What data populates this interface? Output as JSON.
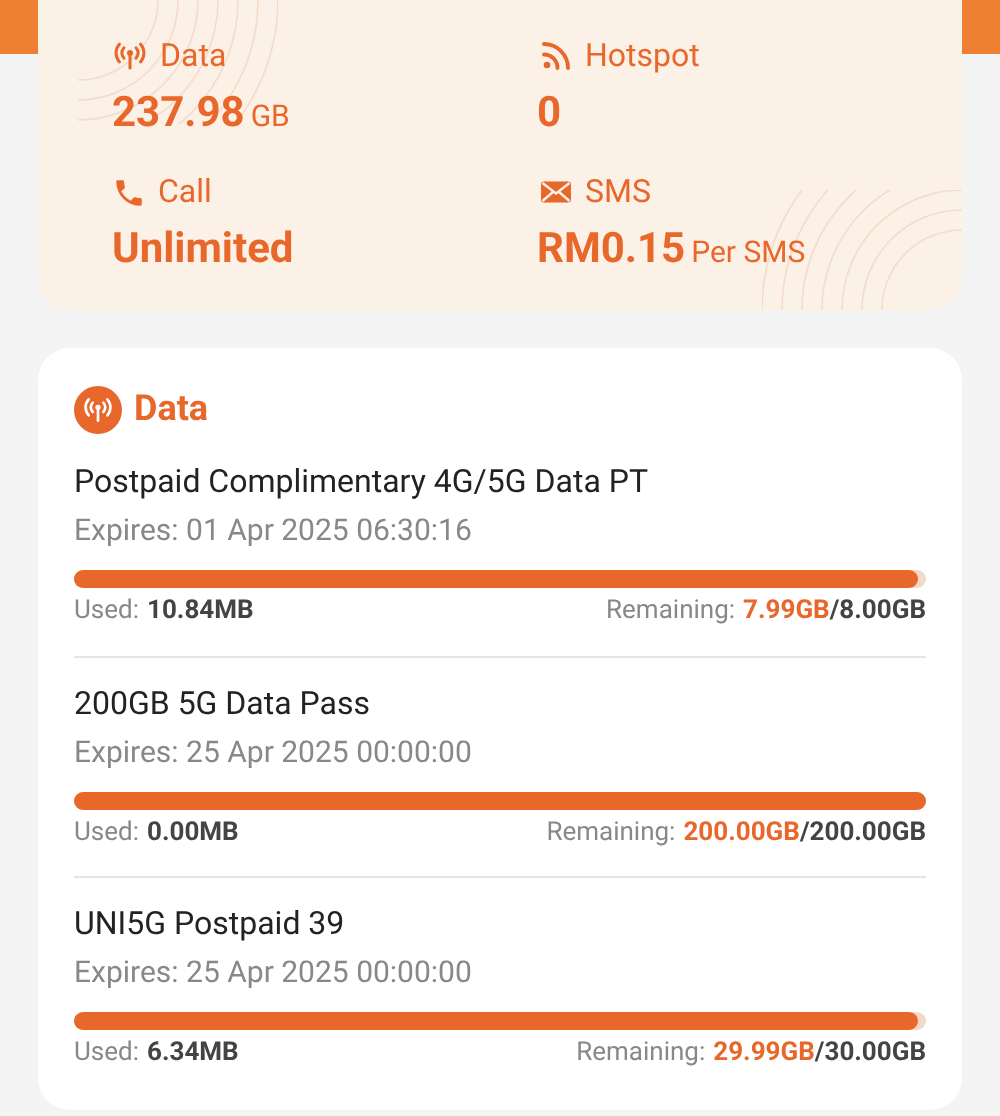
{
  "summary": [
    {
      "kind": "data",
      "label": "Data",
      "value": "237.98",
      "unit": "GB"
    },
    {
      "kind": "hotspot",
      "label": "Hotspot",
      "value": "0"
    },
    {
      "kind": "call",
      "label": "Call",
      "value": "Unlimited"
    },
    {
      "kind": "sms",
      "label": "SMS",
      "value": "RM0.15",
      "unit": "Per SMS"
    }
  ],
  "data_card": {
    "title": "Data",
    "plans": [
      {
        "name": "Postpaid Complimentary 4G/5G Data PT",
        "expires": "Expires: 01 Apr 2025 06:30:16",
        "level": 0.99,
        "used_label": "Used:",
        "used": "10.84MB",
        "remaining_label": "Remaining:",
        "remaining": "7.99GB",
        "total": "/8.00GB"
      },
      {
        "name": "200GB 5G Data Pass",
        "expires": "Expires: 25 Apr 2025 00:00:00",
        "level": 1,
        "used_label": "Used:",
        "used": "0.00MB",
        "remaining_label": "Remaining:",
        "remaining": "200.00GB",
        "total": "/200.00GB"
      },
      {
        "name": "UNI5G Postpaid 39",
        "expires": "Expires: 25 Apr 2025 00:00:00",
        "level": 0.99,
        "used_label": "Used:",
        "used": "6.34MB",
        "remaining_label": "Remaining:",
        "remaining": "29.99GB",
        "total": "/30.00GB"
      }
    ]
  }
}
